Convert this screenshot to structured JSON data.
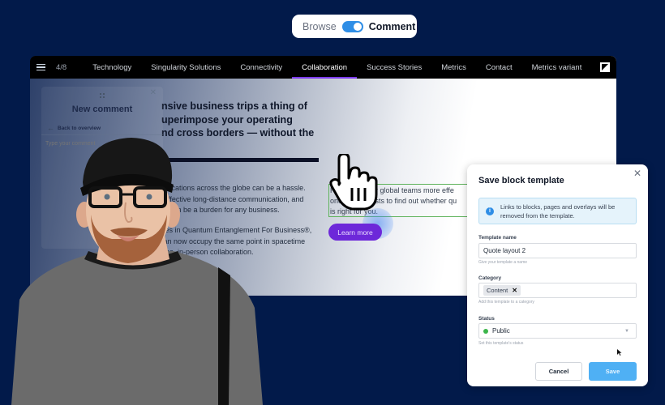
{
  "mode_toggle": {
    "browse_label": "Browse",
    "comment_label": "Comment",
    "active": "Comment",
    "switch_color": "#2f8ee6"
  },
  "navbar": {
    "counter": "4/8",
    "items": [
      {
        "label": "Technology",
        "active": false
      },
      {
        "label": "Singularity Solutions",
        "active": false
      },
      {
        "label": "Connectivity",
        "active": false
      },
      {
        "label": "Collaboration",
        "active": true
      },
      {
        "label": "Success Stories",
        "active": false
      },
      {
        "label": "Metrics",
        "active": false
      },
      {
        "label": "Contact",
        "active": false
      },
      {
        "label": "Metrics variant",
        "active": false
      }
    ],
    "accent_color": "#7c3aed"
  },
  "page": {
    "headline_lines": [
      "nsive business trips a thing of",
      "uperimpose your operating",
      "nd cross borders — without the"
    ],
    "paragraph1_lines": [
      "e locations across the globe can be a hassle.",
      "neffective long-distance communication, and",
      "es can be a burden for any business."
    ],
    "paragraph2_lines": [
      "ices in Quantum Entanglement For Business®,",
      "can now occupy the same point in spacetime",
      "time, in-person collaboration."
    ],
    "cta_lines": [
      "Re            your global teams more effe",
      "one o       cialists to find out whether qu",
      "is right for you."
    ],
    "learn_more_label": "Learn more",
    "button_color": "#6d28d9",
    "selection_color": "#5fb35c"
  },
  "comment_panel": {
    "title": "New comment",
    "back_label": "Back to overview",
    "input_placeholder": "Type your comment"
  },
  "modal": {
    "title": "Save block template",
    "info_text": "Links to blocks, pages and overlays will be removed from the template.",
    "template_name": {
      "label": "Template name",
      "value": "Quote layout 2",
      "hint": "Give your template a name"
    },
    "category": {
      "label": "Category",
      "chips": [
        "Content"
      ],
      "hint": "Add this template to a category"
    },
    "status": {
      "label": "Status",
      "value": "Public",
      "dot_color": "#3bb54a",
      "hint": "Set this template's status"
    },
    "cancel_label": "Cancel",
    "save_label": "Save",
    "save_color": "#4fb0f4"
  }
}
